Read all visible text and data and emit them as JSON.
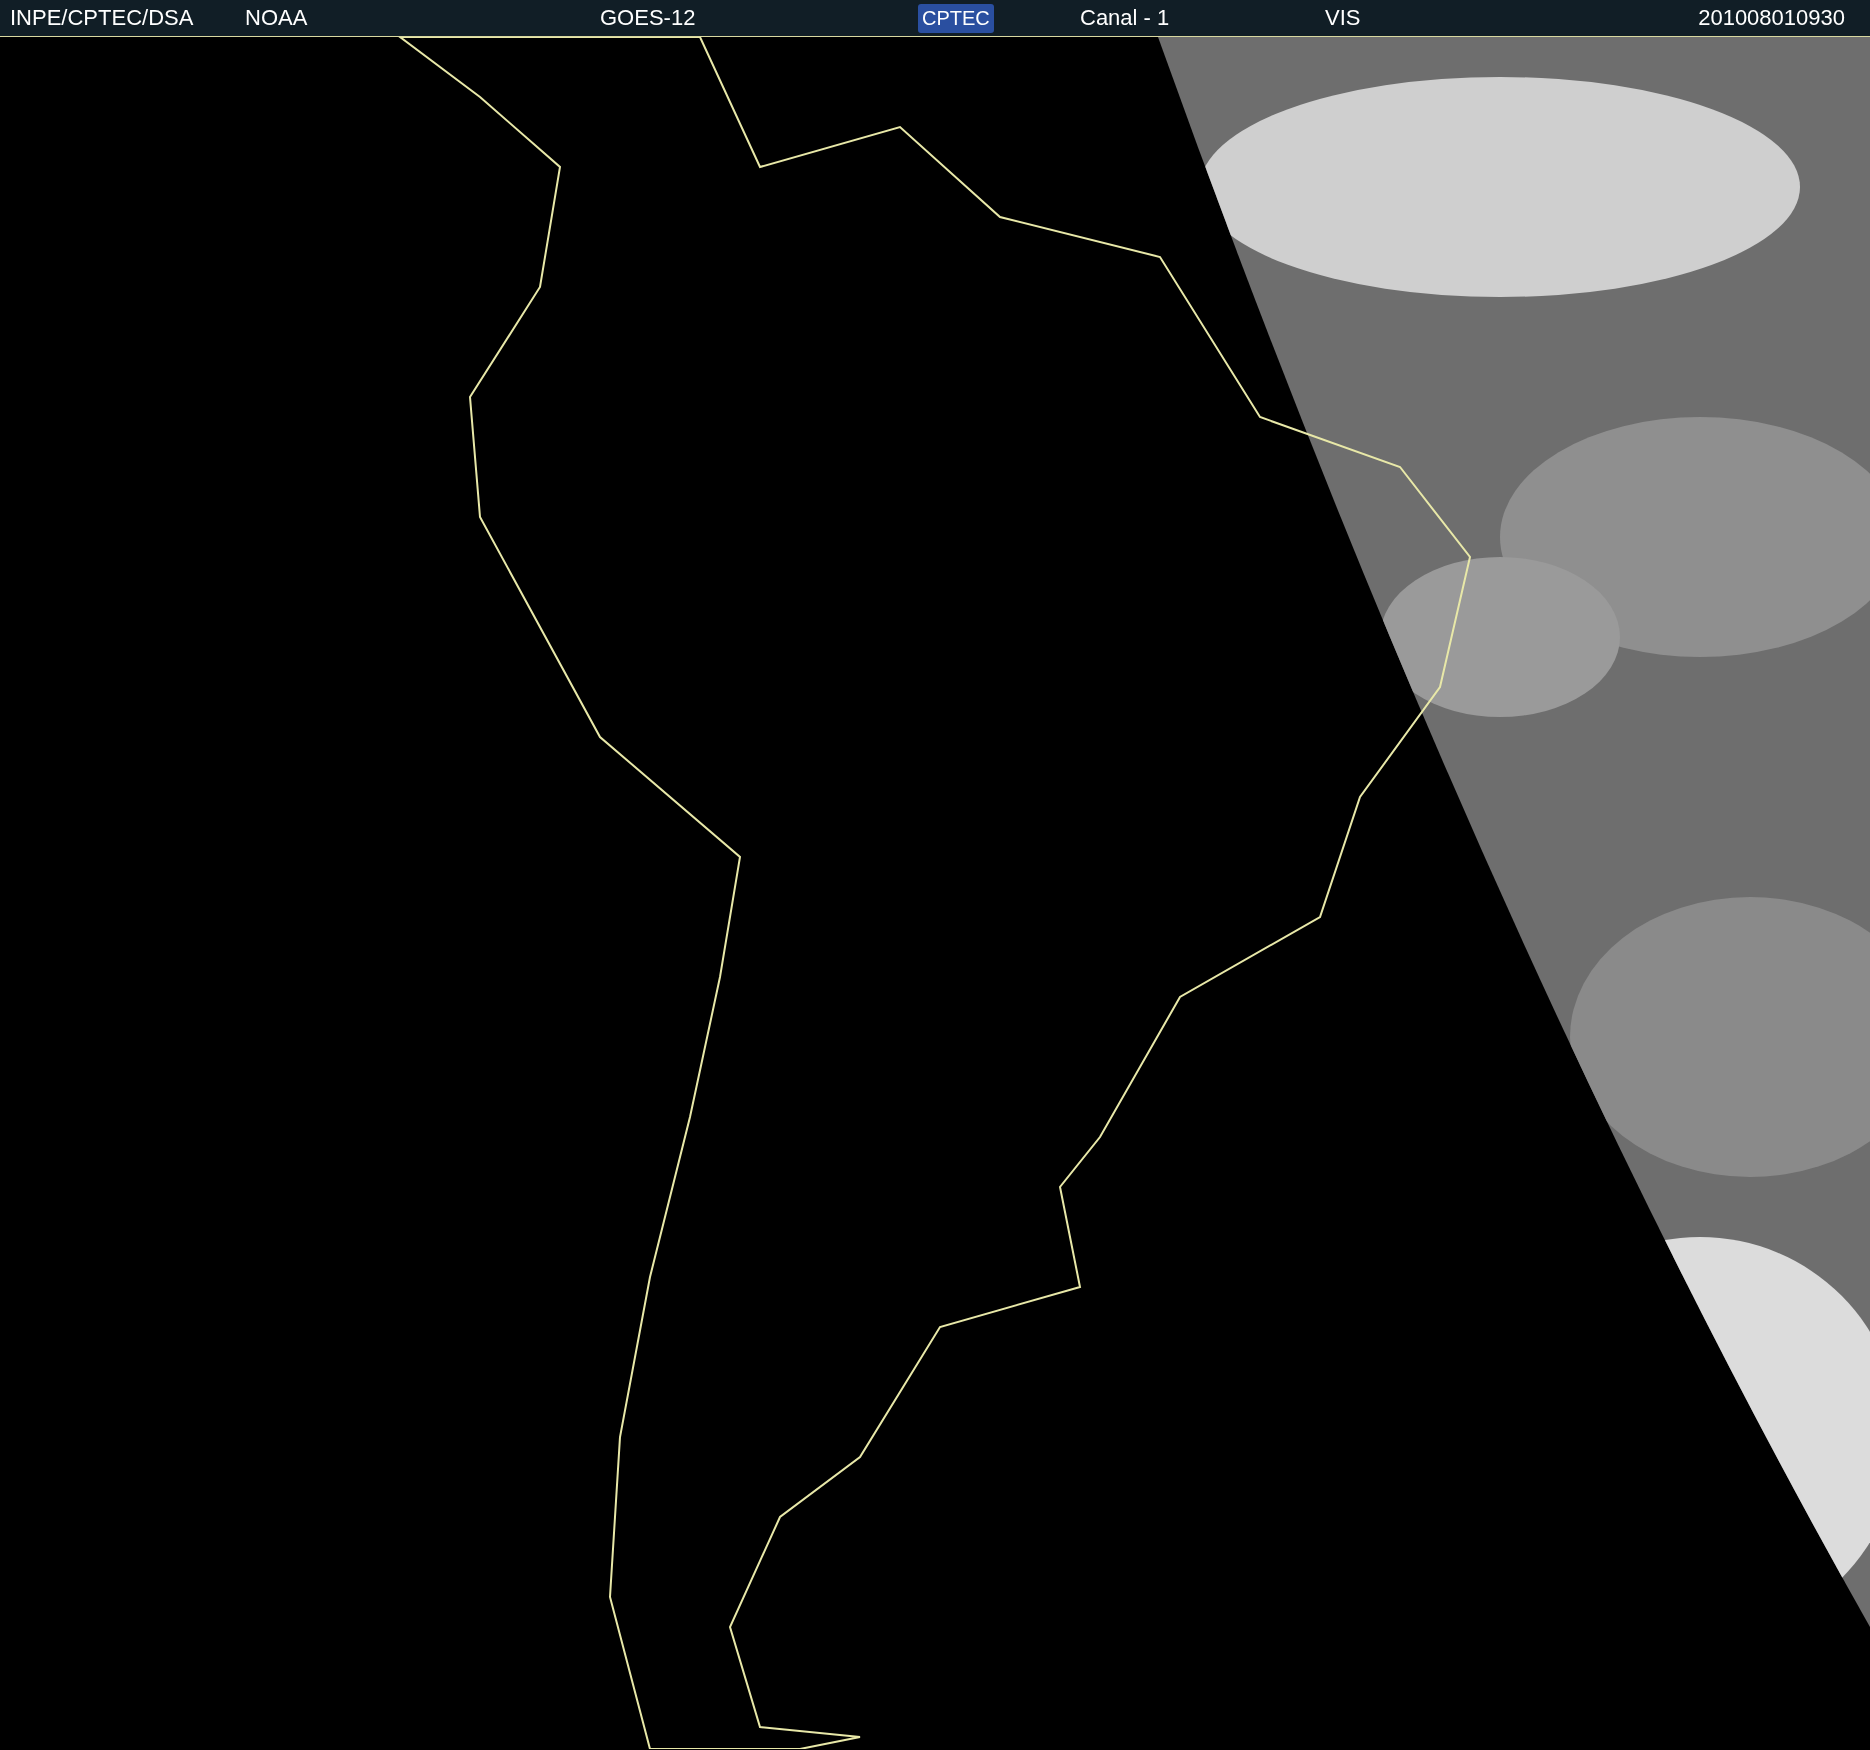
{
  "header": {
    "source": "INPE/CPTEC/DSA",
    "agency": "NOAA",
    "satellite": "GOES-12",
    "logo": "CPTEC",
    "channel": "Canal - 1",
    "band": "VIS",
    "timestamp": "201008010930"
  }
}
